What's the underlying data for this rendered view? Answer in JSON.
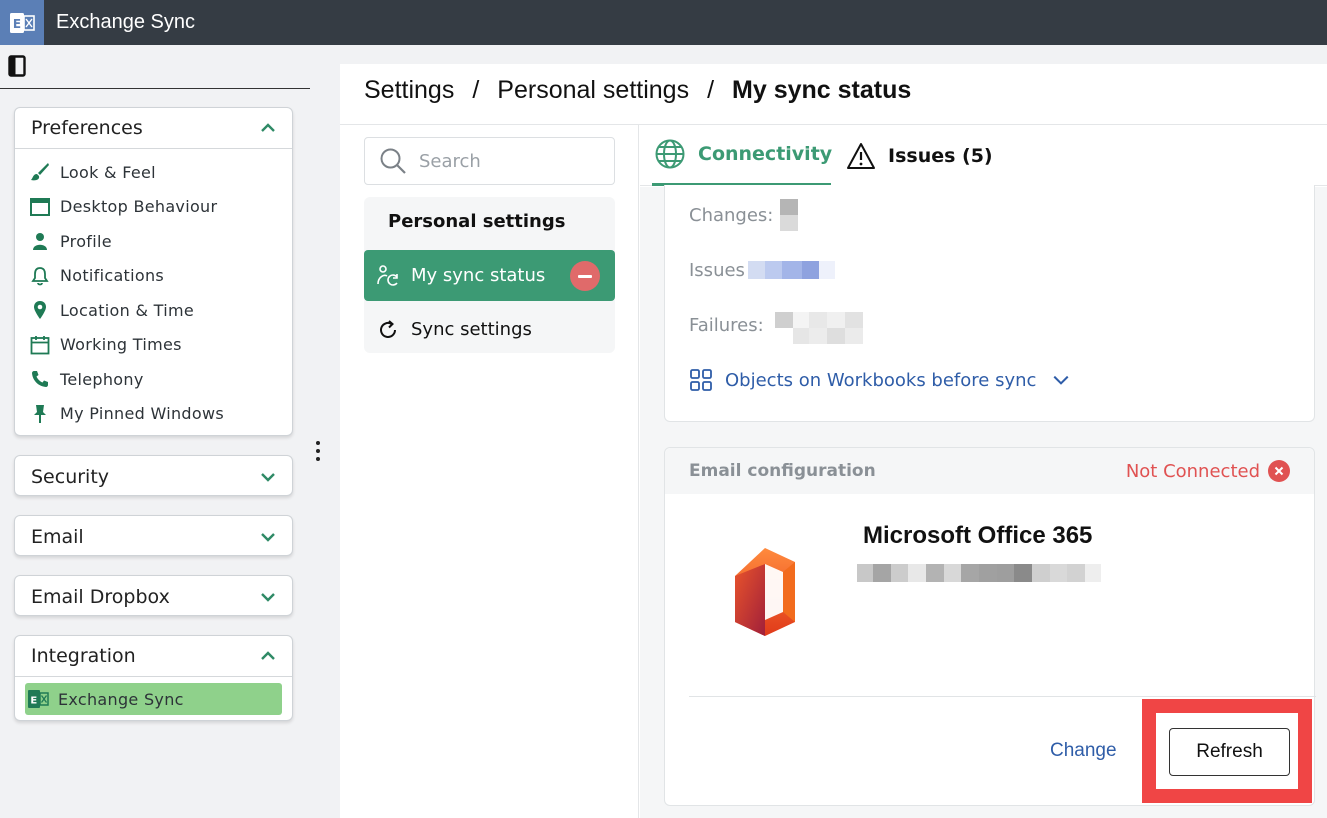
{
  "app": {
    "title": "Exchange Sync",
    "icon": "exchange-app-icon"
  },
  "sidebar": {
    "groups": [
      {
        "label": "Preferences",
        "expanded": true,
        "items": [
          {
            "label": "Look & Feel",
            "icon": "paintbrush-icon"
          },
          {
            "label": "Desktop Behaviour",
            "icon": "window-icon"
          },
          {
            "label": "Profile",
            "icon": "person-icon"
          },
          {
            "label": "Notifications",
            "icon": "bell-icon"
          },
          {
            "label": "Location & Time",
            "icon": "location-pin-icon"
          },
          {
            "label": "Working Times",
            "icon": "calendar-icon"
          },
          {
            "label": "Telephony",
            "icon": "phone-icon"
          },
          {
            "label": "My Pinned Windows",
            "icon": "pin-icon"
          }
        ]
      },
      {
        "label": "Security",
        "expanded": false
      },
      {
        "label": "Email",
        "expanded": false
      },
      {
        "label": "Email Dropbox",
        "expanded": false
      },
      {
        "label": "Integration",
        "expanded": true,
        "items": [
          {
            "label": "Exchange Sync",
            "icon": "exchange-icon",
            "active": true
          }
        ]
      }
    ]
  },
  "breadcrumb": {
    "root": "Settings",
    "sep": "/",
    "parent": "Personal settings",
    "current": "My sync status"
  },
  "search": {
    "placeholder": "Search",
    "value": ""
  },
  "nav": {
    "heading": "Personal settings",
    "items": [
      {
        "label": "My sync status",
        "selected": true
      },
      {
        "label": "Sync settings",
        "selected": false
      }
    ]
  },
  "tabs": [
    {
      "label": "Connectivity",
      "active": true
    },
    {
      "label": "Issues (5)",
      "active": false
    }
  ],
  "stats": {
    "changes_label": "Changes:",
    "issues_label": "Issues",
    "failures_label": "Failures:",
    "objects_link": "Objects on Workbooks before sync"
  },
  "email_config": {
    "title": "Email configuration",
    "status": "Not Connected",
    "provider": "Microsoft Office 365",
    "change_label": "Change",
    "refresh_label": "Refresh"
  },
  "colors": {
    "accent": "#3c9a74",
    "active_item": "#8fd18b",
    "error": "#e05252",
    "link": "#2f5da8",
    "highlight": "#f04545"
  }
}
